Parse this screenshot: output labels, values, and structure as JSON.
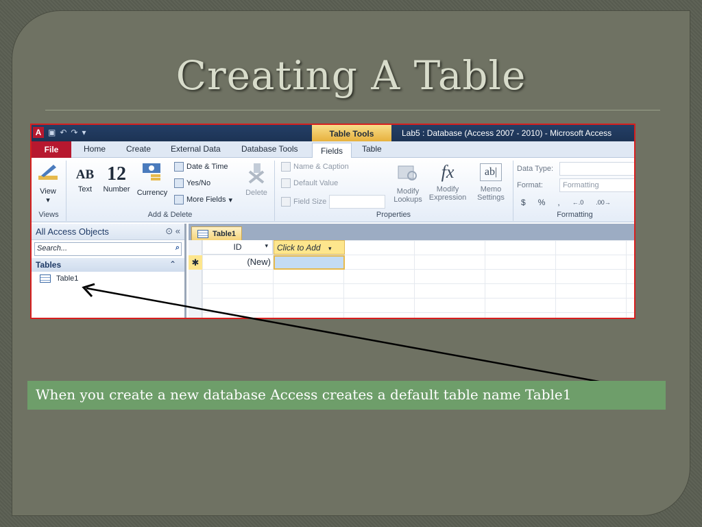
{
  "slide": {
    "title": "Creating A Table",
    "caption": "When you create a new database Access creates a default table name Table1"
  },
  "window": {
    "app_icon": "A",
    "context_tab": "Table Tools",
    "title": "Lab5 : Database (Access 2007 - 2010)  -  Microsoft Access"
  },
  "tabs": {
    "file": "File",
    "home": "Home",
    "create": "Create",
    "external": "External Data",
    "dbtools": "Database Tools",
    "fields": "Fields",
    "table": "Table"
  },
  "ribbon": {
    "view": "View",
    "text": "Text",
    "number": "Number",
    "currency": "Currency",
    "date_time": "Date & Time",
    "yes_no": "Yes/No",
    "more_fields": "More Fields",
    "delete": "Delete",
    "name_caption": "Name & Caption",
    "default_value": "Default Value",
    "field_size": "Field Size",
    "modify_lookups_1": "Modify",
    "modify_lookups_2": "Lookups",
    "modify_expr_1": "Modify",
    "modify_expr_2": "Expression",
    "memo_1": "Memo",
    "memo_2": "Settings",
    "data_type": "Data Type:",
    "format": "Format:",
    "format_value": "Formatting",
    "currency_sym": "$",
    "percent_sym": "%",
    "comma_sym": ",",
    "groups": {
      "views": "Views",
      "add_delete": "Add & Delete",
      "properties": "Properties",
      "formatting": "Formatting"
    },
    "ab_glyph": "AB",
    "num_glyph": "12",
    "fx_glyph": "fx",
    "abl_glyph": "ab|"
  },
  "nav": {
    "header": "All Access Objects",
    "search_placeholder": "Search...",
    "group": "Tables",
    "item": "Table1"
  },
  "doc": {
    "tab": "Table1",
    "col_id": "ID",
    "col_add": "Click to Add",
    "new_row": "(New)",
    "new_marker": "✱"
  }
}
